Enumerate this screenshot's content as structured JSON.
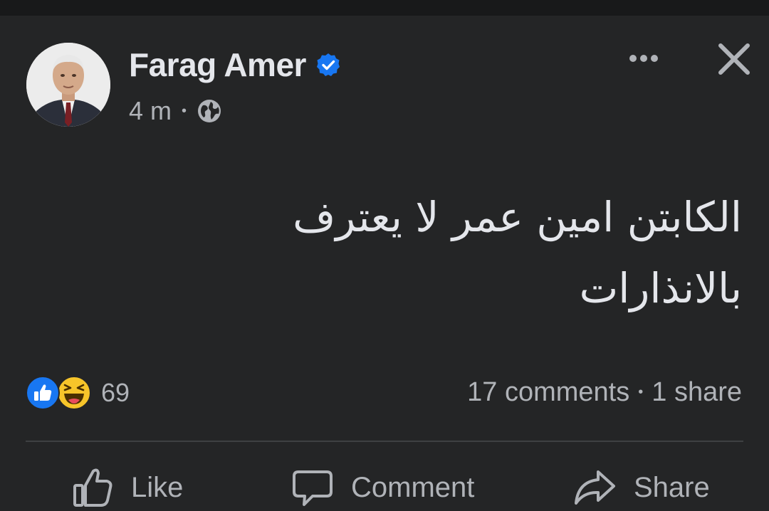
{
  "post": {
    "author": "Farag Amer",
    "time": "4 m",
    "visibility_icon": "globe-icon",
    "text_line1": "الكابتن امين عمر لا يعترف",
    "text_line2": "بالانذارات"
  },
  "reactions": {
    "icons": [
      "like-reaction-icon",
      "haha-reaction-icon"
    ],
    "count": "69"
  },
  "stats": {
    "comments": "17 comments",
    "separator": "•",
    "shares": "1 share"
  },
  "actions": {
    "like": "Like",
    "comment": "Comment",
    "share": "Share"
  },
  "colors": {
    "background": "#242526",
    "text_primary": "#e4e6eb",
    "text_secondary": "#b0b3b8",
    "accent_blue": "#1877f2",
    "haha_yellow": "#f7c52a"
  }
}
